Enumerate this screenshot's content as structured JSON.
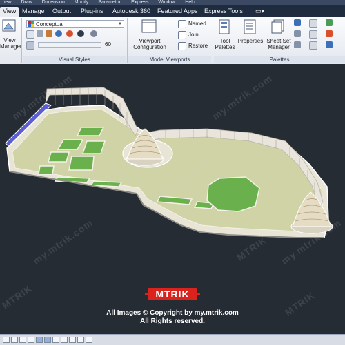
{
  "menubar": {
    "items": [
      "iew",
      "Draw",
      "Dimension",
      "Modify",
      "Parametric",
      "Express",
      "Window",
      "Help"
    ]
  },
  "tabs": [
    "View",
    "Manage",
    "Output",
    "Plug-ins",
    "Autodesk 360",
    "Featured Apps",
    "Express Tools"
  ],
  "active_tab": "View",
  "ribbon": {
    "view_manager": {
      "line1": "View",
      "line2": "Manager"
    },
    "visual_styles": {
      "dropdown_value": "Conceptual",
      "spin_value": "60",
      "title": "Visual Styles"
    },
    "model_viewports": {
      "viewport_config": {
        "line1": "Viewport",
        "line2": "Configuration"
      },
      "named": "Named",
      "join": "Join",
      "restore": "Restore",
      "title": "Model Viewports"
    },
    "palettes": {
      "tool_palettes": {
        "line1": "Tool",
        "line2": "Palettes"
      },
      "properties": "Properties",
      "sheet_set": {
        "line1": "Sheet Set",
        "line2": "Manager"
      },
      "title": "Palettes"
    }
  },
  "watermark": {
    "brand": "MTRIK",
    "url": "my.mtrik.com"
  },
  "footer": {
    "logo": "MTRIK",
    "copyright": "All Images © Copyright by my.mtrik.com",
    "rights": "All Rights reserved."
  },
  "colors": {
    "canvas": "#262c34",
    "lawn": "#cfd3a5",
    "grass": "#6ab04c",
    "wall": "#e9e5dd",
    "accent_logo": "#d9231c"
  }
}
